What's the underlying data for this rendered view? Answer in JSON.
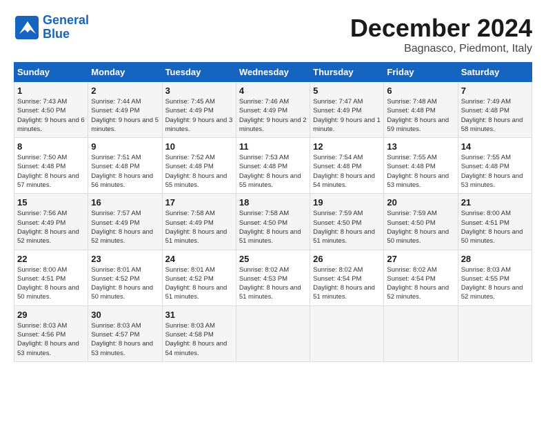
{
  "logo": {
    "line1": "General",
    "line2": "Blue"
  },
  "title": "December 2024",
  "location": "Bagnasco, Piedmont, Italy",
  "days_of_week": [
    "Sunday",
    "Monday",
    "Tuesday",
    "Wednesday",
    "Thursday",
    "Friday",
    "Saturday"
  ],
  "weeks": [
    [
      {
        "day": "1",
        "sunrise": "7:43 AM",
        "sunset": "4:50 PM",
        "daylight": "9 hours and 6 minutes."
      },
      {
        "day": "2",
        "sunrise": "7:44 AM",
        "sunset": "4:49 PM",
        "daylight": "9 hours and 5 minutes."
      },
      {
        "day": "3",
        "sunrise": "7:45 AM",
        "sunset": "4:49 PM",
        "daylight": "9 hours and 3 minutes."
      },
      {
        "day": "4",
        "sunrise": "7:46 AM",
        "sunset": "4:49 PM",
        "daylight": "9 hours and 2 minutes."
      },
      {
        "day": "5",
        "sunrise": "7:47 AM",
        "sunset": "4:49 PM",
        "daylight": "9 hours and 1 minute."
      },
      {
        "day": "6",
        "sunrise": "7:48 AM",
        "sunset": "4:48 PM",
        "daylight": "8 hours and 59 minutes."
      },
      {
        "day": "7",
        "sunrise": "7:49 AM",
        "sunset": "4:48 PM",
        "daylight": "8 hours and 58 minutes."
      }
    ],
    [
      {
        "day": "8",
        "sunrise": "7:50 AM",
        "sunset": "4:48 PM",
        "daylight": "8 hours and 57 minutes."
      },
      {
        "day": "9",
        "sunrise": "7:51 AM",
        "sunset": "4:48 PM",
        "daylight": "8 hours and 56 minutes."
      },
      {
        "day": "10",
        "sunrise": "7:52 AM",
        "sunset": "4:48 PM",
        "daylight": "8 hours and 55 minutes."
      },
      {
        "day": "11",
        "sunrise": "7:53 AM",
        "sunset": "4:48 PM",
        "daylight": "8 hours and 55 minutes."
      },
      {
        "day": "12",
        "sunrise": "7:54 AM",
        "sunset": "4:48 PM",
        "daylight": "8 hours and 54 minutes."
      },
      {
        "day": "13",
        "sunrise": "7:55 AM",
        "sunset": "4:48 PM",
        "daylight": "8 hours and 53 minutes."
      },
      {
        "day": "14",
        "sunrise": "7:55 AM",
        "sunset": "4:48 PM",
        "daylight": "8 hours and 53 minutes."
      }
    ],
    [
      {
        "day": "15",
        "sunrise": "7:56 AM",
        "sunset": "4:49 PM",
        "daylight": "8 hours and 52 minutes."
      },
      {
        "day": "16",
        "sunrise": "7:57 AM",
        "sunset": "4:49 PM",
        "daylight": "8 hours and 52 minutes."
      },
      {
        "day": "17",
        "sunrise": "7:58 AM",
        "sunset": "4:49 PM",
        "daylight": "8 hours and 51 minutes."
      },
      {
        "day": "18",
        "sunrise": "7:58 AM",
        "sunset": "4:50 PM",
        "daylight": "8 hours and 51 minutes."
      },
      {
        "day": "19",
        "sunrise": "7:59 AM",
        "sunset": "4:50 PM",
        "daylight": "8 hours and 51 minutes."
      },
      {
        "day": "20",
        "sunrise": "7:59 AM",
        "sunset": "4:50 PM",
        "daylight": "8 hours and 50 minutes."
      },
      {
        "day": "21",
        "sunrise": "8:00 AM",
        "sunset": "4:51 PM",
        "daylight": "8 hours and 50 minutes."
      }
    ],
    [
      {
        "day": "22",
        "sunrise": "8:00 AM",
        "sunset": "4:51 PM",
        "daylight": "8 hours and 50 minutes."
      },
      {
        "day": "23",
        "sunrise": "8:01 AM",
        "sunset": "4:52 PM",
        "daylight": "8 hours and 50 minutes."
      },
      {
        "day": "24",
        "sunrise": "8:01 AM",
        "sunset": "4:52 PM",
        "daylight": "8 hours and 51 minutes."
      },
      {
        "day": "25",
        "sunrise": "8:02 AM",
        "sunset": "4:53 PM",
        "daylight": "8 hours and 51 minutes."
      },
      {
        "day": "26",
        "sunrise": "8:02 AM",
        "sunset": "4:54 PM",
        "daylight": "8 hours and 51 minutes."
      },
      {
        "day": "27",
        "sunrise": "8:02 AM",
        "sunset": "4:54 PM",
        "daylight": "8 hours and 52 minutes."
      },
      {
        "day": "28",
        "sunrise": "8:03 AM",
        "sunset": "4:55 PM",
        "daylight": "8 hours and 52 minutes."
      }
    ],
    [
      {
        "day": "29",
        "sunrise": "8:03 AM",
        "sunset": "4:56 PM",
        "daylight": "8 hours and 53 minutes."
      },
      {
        "day": "30",
        "sunrise": "8:03 AM",
        "sunset": "4:57 PM",
        "daylight": "8 hours and 53 minutes."
      },
      {
        "day": "31",
        "sunrise": "8:03 AM",
        "sunset": "4:58 PM",
        "daylight": "8 hours and 54 minutes."
      },
      null,
      null,
      null,
      null
    ]
  ]
}
